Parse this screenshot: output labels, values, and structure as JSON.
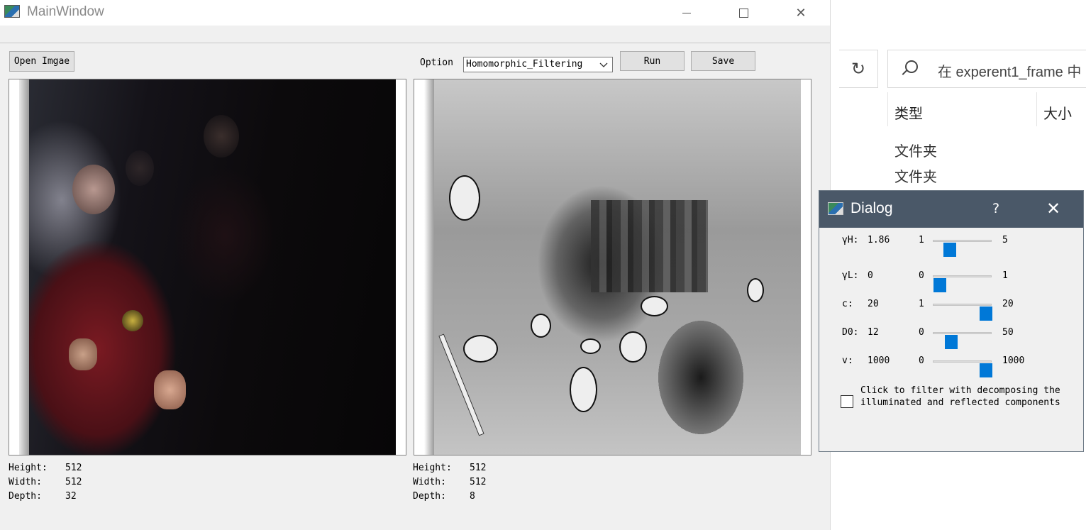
{
  "main_window": {
    "title": "MainWindow",
    "open_button": "Open Imgae",
    "option_label": "Option",
    "option_selected": "Homomorphic_Filtering",
    "run_button": "Run",
    "save_button": "Save",
    "left_info": {
      "height_label": "Height:",
      "height": "512",
      "width_label": "Width:",
      "width": "512",
      "depth_label": "Depth:",
      "depth": "32"
    },
    "right_info": {
      "height_label": "Height:",
      "height": "512",
      "width_label": "Width:",
      "width": "512",
      "depth_label": "Depth:",
      "depth": "8"
    }
  },
  "explorer": {
    "search_placeholder": "在 experent1_frame 中",
    "columns": [
      "类型",
      "大小"
    ],
    "types": [
      "文件夹",
      "文件夹"
    ]
  },
  "dialog": {
    "title": "Dialog",
    "help": "?",
    "params": [
      {
        "label": "γH:",
        "value": "1.86",
        "min": "1",
        "max": "5",
        "level": 0.215
      },
      {
        "label": "γL:",
        "value": "0",
        "min": "0",
        "max": "1",
        "level": 0.0
      },
      {
        "label": "c:",
        "value": "20",
        "min": "1",
        "max": "20",
        "level": 1.0
      },
      {
        "label": "D0:",
        "value": "12",
        "min": "0",
        "max": "50",
        "level": 0.24
      },
      {
        "label": "v:",
        "value": "1000",
        "min": "0",
        "max": "1000",
        "level": 1.0
      }
    ],
    "checkbox_label": "Click to filter with decomposing the\nilluminated and reflected components",
    "checkbox_checked": false
  },
  "colors": {
    "slider_handle": "#0078d7",
    "dialog_titlebar": "#4a5868"
  }
}
